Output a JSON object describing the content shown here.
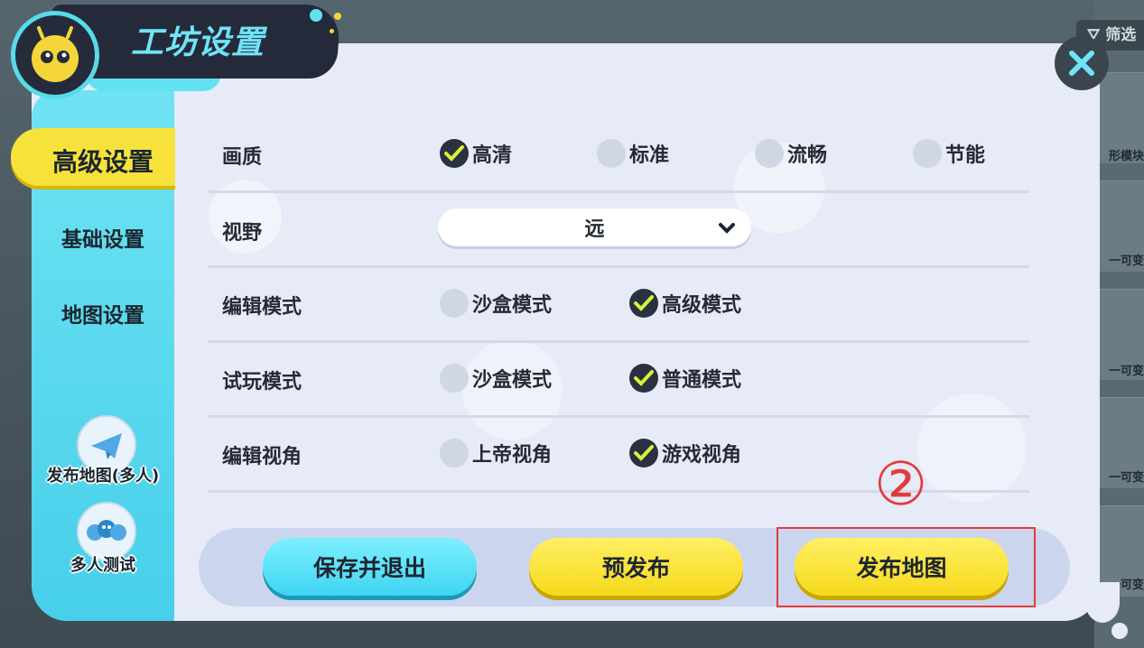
{
  "header": {
    "title": "工坊设置"
  },
  "background": {
    "filter_label": "筛选",
    "shop_labels": [
      "形模块",
      "一可变",
      "一可变",
      "一可变",
      "一可变"
    ]
  },
  "sidebar": {
    "tabs": [
      {
        "label": "高级设置",
        "active": true
      },
      {
        "label": "基础设置",
        "active": false
      },
      {
        "label": "地图设置",
        "active": false
      }
    ],
    "actions": [
      {
        "label": "发布地图(多人)",
        "icon": "paper-plane-icon"
      },
      {
        "label": "多人测试",
        "icon": "multiplayer-icon"
      }
    ]
  },
  "settings": {
    "quality": {
      "label": "画质",
      "options": [
        "高清",
        "标准",
        "流畅",
        "节能"
      ],
      "selected": "高清"
    },
    "view_distance": {
      "label": "视野",
      "value": "远"
    },
    "edit_mode": {
      "label": "编辑模式",
      "options": [
        "沙盒模式",
        "高级模式"
      ],
      "selected": "高级模式"
    },
    "test_mode": {
      "label": "试玩模式",
      "options": [
        "沙盒模式",
        "普通模式"
      ],
      "selected": "普通模式"
    },
    "edit_view": {
      "label": "编辑视角",
      "options": [
        "上帝视角",
        "游戏视角"
      ],
      "selected": "游戏视角"
    }
  },
  "buttons": {
    "save_exit": "保存并退出",
    "pre_publish": "预发布",
    "publish_map": "发布地图"
  },
  "annotation": {
    "step_marker": "②"
  },
  "colors": {
    "accent_cyan": "#58dbe8",
    "accent_yellow": "#f7e23b",
    "annotation_red": "#e23b3b",
    "panel_bg": "#e6ebf7"
  }
}
